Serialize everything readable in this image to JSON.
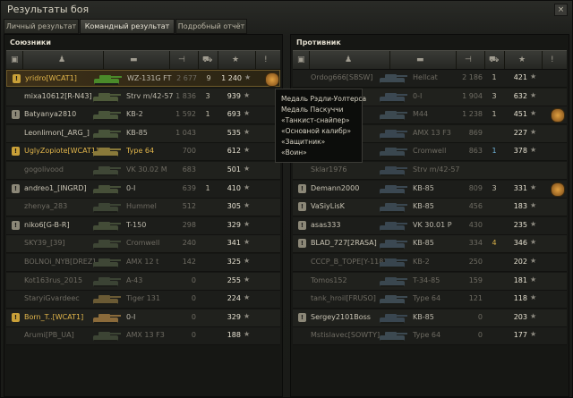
{
  "window": {
    "title": "Результаты боя",
    "close": "×"
  },
  "tabs": [
    {
      "label": "Личный результат"
    },
    {
      "label": "Командный результат"
    },
    {
      "label": "Подробный отчёт"
    }
  ],
  "left": {
    "title": "Союзники",
    "rows": [
      {
        "name": "yridro[WCAT1]",
        "vehicle": "WZ-131G FT",
        "damage": "2 677",
        "kills": "9",
        "xp": "1 240",
        "self": true,
        "gold": true,
        "platoon": true,
        "medal": true,
        "tank_color": "#4a8a2a"
      },
      {
        "name": "mixa10612[R-N43]",
        "vehicle": "Strv m/42-57",
        "damage": "1 836",
        "kills": "3",
        "xp": "939",
        "tank_color": "#4e5a3a"
      },
      {
        "name": "Batyanya2810",
        "vehicle": "KB-2",
        "damage": "1 592",
        "kills": "1",
        "xp": "693",
        "platoon": true,
        "tank_color": "#49553a"
      },
      {
        "name": "Leonlimon[_ARG_]",
        "vehicle": "KB-85",
        "damage": "1 043",
        "kills": "",
        "xp": "535",
        "tank_color": "#48543a"
      },
      {
        "name": "UglyZopiote[WCAT1]",
        "vehicle": "Type 64",
        "damage": "700",
        "kills": "",
        "xp": "612",
        "gold": true,
        "platoon": true,
        "vgold": true,
        "tank_color": "#8a7a3a"
      },
      {
        "name": "gogolivood",
        "vehicle": "VK 30.02 M",
        "damage": "683",
        "kills": "",
        "xp": "501",
        "dead": true,
        "tank_color": "#3f4736"
      },
      {
        "name": "andreo1_[INGRD]",
        "vehicle": "0-I",
        "damage": "639",
        "kills": "1",
        "xp": "410",
        "platoon": true,
        "tank_color": "#464f38"
      },
      {
        "name": "zhenya_283",
        "vehicle": "Hummel",
        "damage": "512",
        "kills": "",
        "xp": "305",
        "dead": true,
        "tank_color": "#3c4434"
      },
      {
        "name": "niko6[G-B-R]",
        "vehicle": "T-150",
        "damage": "298",
        "kills": "",
        "xp": "329",
        "platoon": true,
        "tank_color": "#434c37"
      },
      {
        "name": "SKY39_[39]",
        "vehicle": "Cromwell",
        "damage": "240",
        "kills": "",
        "xp": "341",
        "dead": true,
        "tank_color": "#3e4635"
      },
      {
        "name": "BOLNOi_NYB[DREZ]",
        "vehicle": "AMX 12 t",
        "damage": "142",
        "kills": "",
        "xp": "325",
        "dead": true,
        "tank_color": "#3f4736"
      },
      {
        "name": "Kot163rus_2015",
        "vehicle": "A-43",
        "damage": "0",
        "kills": "",
        "xp": "255",
        "dead": true,
        "tank_color": "#3b4334"
      },
      {
        "name": "StaryiGvardeec",
        "vehicle": "Tiger 131",
        "damage": "0",
        "kills": "",
        "xp": "224",
        "dead": true,
        "vgold": true,
        "tank_color": "#6a5a34"
      },
      {
        "name": "Born_T..[WCAT1]",
        "vehicle": "0-I",
        "damage": "0",
        "kills": "",
        "xp": "329",
        "gold": true,
        "platoon": true,
        "tank_color": "#8a6a3a"
      },
      {
        "name": "Arumi[PB_UA]",
        "vehicle": "AMX 13 F3",
        "damage": "0",
        "kills": "",
        "xp": "188",
        "dead": true,
        "tank_color": "#3c4434"
      }
    ]
  },
  "right": {
    "title": "Противник",
    "rows": [
      {
        "name": "Ordog666[SBSW]",
        "vehicle": "Hellcat",
        "damage": "2 186",
        "kills": "1",
        "xp": "421",
        "dead": true,
        "vblue": true,
        "tank_color": "#3d4a52"
      },
      {
        "name": "",
        "vehicle": "0-I",
        "damage": "1 904",
        "kills": "3",
        "xp": "632",
        "dead": true,
        "tank_color": "#3b4852"
      },
      {
        "name": "",
        "vehicle": "M44",
        "damage": "1 238",
        "kills": "1",
        "xp": "451",
        "dead": true,
        "medal": true,
        "tank_color": "#3c4950"
      },
      {
        "name": "",
        "vehicle": "AMX 13 F3",
        "damage": "869",
        "kills": "",
        "xp": "227",
        "dead": true,
        "tank_color": "#394650"
      },
      {
        "name": "",
        "vehicle": "Cromwell",
        "damage": "863",
        "kills": "1",
        "xp": "378",
        "dead": true,
        "tank_color": "#3a474f",
        "kblue": true
      },
      {
        "name": "Sklar1976",
        "vehicle": "Strv m/42-57",
        "damage": "",
        "kills": "",
        "xp": "",
        "dead": true,
        "tank_color": "#38444d"
      },
      {
        "name": "Demann2000",
        "vehicle": "KB-85",
        "damage": "809",
        "kills": "3",
        "xp": "331",
        "platoon": true,
        "medal": true,
        "tank_color": "#3b4852"
      },
      {
        "name": "VaSiyLisK",
        "vehicle": "KB-85",
        "damage": "456",
        "kills": "",
        "xp": "183",
        "platoon": true,
        "tank_color": "#3a4750"
      },
      {
        "name": "asas333",
        "vehicle": "VK 30.01 P",
        "damage": "430",
        "kills": "",
        "xp": "235",
        "platoon": true,
        "tank_color": "#394650"
      },
      {
        "name": "BLAD_727[2RASA]",
        "vehicle": "KB-85",
        "damage": "334",
        "kills": "4",
        "xp": "346",
        "platoon": true,
        "kyellow": true,
        "tank_color": "#3b4852"
      },
      {
        "name": "CCCP_B_TOPE[Y-118]",
        "vehicle": "KB-2",
        "damage": "250",
        "kills": "",
        "xp": "202",
        "dead": true,
        "tank_color": "#38454e"
      },
      {
        "name": "Tomos152",
        "vehicle": "T-34-85",
        "damage": "159",
        "kills": "",
        "xp": "181",
        "dead": true,
        "tank_color": "#3a474f"
      },
      {
        "name": "tank_hroil[FRUSO]",
        "vehicle": "Type 64",
        "damage": "121",
        "kills": "",
        "xp": "118",
        "dead": true,
        "vblue": true,
        "tank_color": "#3d4a52"
      },
      {
        "name": "Sergey2101Boss",
        "vehicle": "KB-85",
        "damage": "0",
        "kills": "",
        "xp": "203",
        "platoon": true,
        "tank_color": "#394650"
      },
      {
        "name": "Mstislavec[SOWTY]",
        "vehicle": "Type 64",
        "damage": "0",
        "kills": "",
        "xp": "177",
        "dead": true,
        "vblue": true,
        "tank_color": "#3c4951"
      }
    ]
  },
  "tooltip": {
    "lines": [
      "Медаль Рэдли-Уолтерса",
      "Медаль Паскуччи",
      "«Танкист-снайпер»",
      "«Основной калибр»",
      "«Защитник»",
      "«Воин»"
    ]
  },
  "icons": {
    "star": "★",
    "platoon": "platoon-icon"
  }
}
